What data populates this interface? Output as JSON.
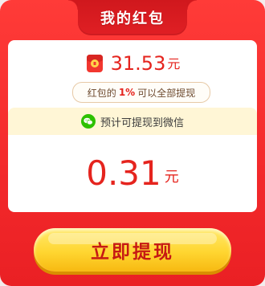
{
  "header": {
    "title": "我的红包"
  },
  "balance": {
    "amount": "31.53",
    "unit": "元",
    "icon": "red-envelope-icon"
  },
  "note": {
    "prefix": "红包的",
    "percent": "1%",
    "suffix": "可以全部提现"
  },
  "destination": {
    "icon": "wechat-icon",
    "text": "预计可提现到微信"
  },
  "withdraw": {
    "amount": "0.31",
    "unit": "元"
  },
  "cta": {
    "label": "立即提现"
  },
  "colors": {
    "primary_red": "#f42a2c",
    "amount_red": "#e5241e",
    "button_yellow": "#ffd631",
    "wechat_green": "#2dc100"
  }
}
